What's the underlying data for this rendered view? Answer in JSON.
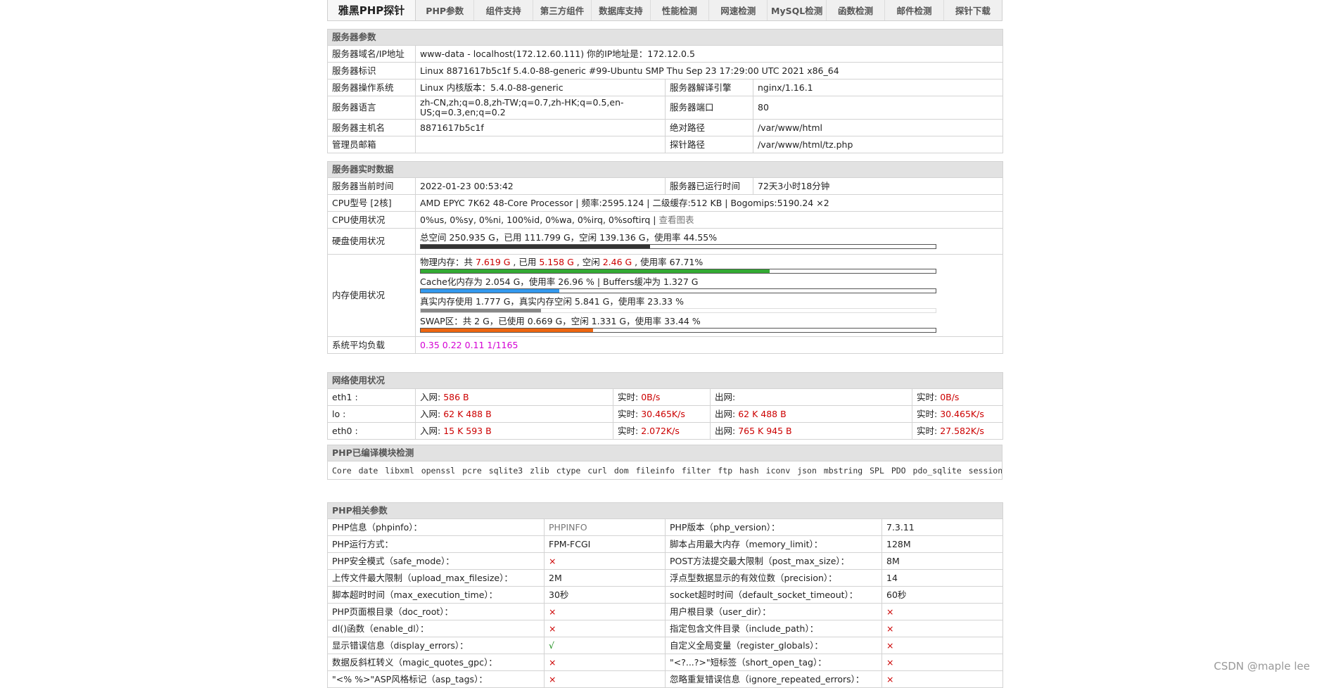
{
  "nav": {
    "brand": "雅黑PHP探针",
    "links": [
      "PHP参数",
      "组件支持",
      "第三方组件",
      "数据库支持",
      "性能检测",
      "网速检测",
      "MySQL检测",
      "函数检测",
      "邮件检测",
      "探针下载"
    ]
  },
  "server": {
    "title": "服务器参数",
    "rows": {
      "domain_label": "服务器域名/IP地址",
      "domain_value": "www-data - localhost(172.12.60.111)  你的IP地址是：172.12.0.5",
      "id_label": "服务器标识",
      "id_value": "Linux 8871617b5c1f 5.4.0-88-generic #99-Ubuntu SMP Thu Sep 23 17:29:00 UTC 2021 x86_64",
      "os_label": "服务器操作系统",
      "os_value": "Linux  内核版本：5.4.0-88-generic",
      "engine_label": "服务器解译引擎",
      "engine_value": "nginx/1.16.1",
      "lang_label": "服务器语言",
      "lang_value": "zh-CN,zh;q=0.8,zh-TW;q=0.7,zh-HK;q=0.5,en-US;q=0.3,en;q=0.2",
      "port_label": "服务器端口",
      "port_value": "80",
      "host_label": "服务器主机名",
      "host_value": "8871617b5c1f",
      "abs_label": "绝对路径",
      "abs_value": "/var/www/html",
      "admin_label": "管理员邮箱",
      "admin_value": "",
      "probe_label": "探针路径",
      "probe_value": "/var/www/html/tz.php"
    }
  },
  "realtime": {
    "title": "服务器实时数据",
    "time_label": "服务器当前时间",
    "time_value": "2022-01-23 00:53:42",
    "uptime_label": "服务器已运行时间",
    "uptime_value": "72天3小时18分钟",
    "cpu_model_label": "CPU型号 [2核]",
    "cpu_model_value": "AMD EPYC 7K62 48-Core Processor | 频率:2595.124 | 二级缓存:512 KB | Bogomips:5190.24 ×2",
    "cpu_usage_label": "CPU使用状况",
    "cpu_usage_value": "0%us, 0%sy, 0%ni, 100%id, 0%wa, 0%irq, 0%softirq |",
    "cpu_chart_link": "查看图表",
    "disk_label": "硬盘使用状况",
    "disk_value": "总空间 250.935 G，已用 111.799 G，空闲 139.136 G，使用率 44.55%",
    "disk_pct": 0.4455,
    "mem_label": "内存使用状况",
    "mem_physical": {
      "a": "物理内存：共 ",
      "total": "7.619 G",
      "b": " , 已用 ",
      "used": "5.158 G",
      "c": " , 空闲 ",
      "free": "2.46 G",
      "d": " , 使用率 67.71%"
    },
    "mem_physical_pct": 0.6771,
    "mem_cache": "Cache化内存为 2.054 G，使用率 26.96 % | Buffers缓冲为 1.327 G",
    "mem_cache_pct": 0.2696,
    "mem_real": "真实内存使用 1.777 G，真实内存空闲 5.841 G，使用率 23.33 %",
    "mem_real_pct": 0.2333,
    "mem_swap": "SWAP区：共 2 G，已使用 0.669 G，空闲 1.331 G，使用率 33.44 %",
    "mem_swap_pct": 0.3344,
    "load_label": "系统平均负载",
    "load_value": "0.35 0.22 0.11 1/1165",
    "colors": {
      "disk": "#333333",
      "physical": "#33aa33",
      "cache": "#3399ee",
      "real": "#888888",
      "swap": "#ee6611"
    }
  },
  "network": {
    "title": "网络使用状况",
    "in_label": "入网: ",
    "out_label": "出网: ",
    "rt_label": "实时: ",
    "rows": [
      {
        "name": "eth1 :",
        "in": "586 B",
        "in_rt": "0B/s",
        "out": "",
        "out_rt": "0B/s"
      },
      {
        "name": "lo :",
        "in": "62 K 488 B",
        "in_rt": "30.465K/s",
        "out": "62 K 488 B",
        "out_rt": "30.465K/s"
      },
      {
        "name": "eth0 :",
        "in": "15 K 593 B",
        "in_rt": "2.072K/s",
        "out": "765 K 945 B",
        "out_rt": "27.582K/s"
      }
    ]
  },
  "modules": {
    "title": "PHP已编译模块检测",
    "list": "Core  date  libxml  openssl  pcre  sqlite3  zlib  ctype  curl  dom  fileinfo  filter  ftp  hash  iconv  json  mbstring  SPL  PDO  pdo_sqlite  session  posix  readline  Reflection  standard  SimpleXML  Phar  tokenizer  xml  xmlreader  xmlwriter  mysqlnd  cgi-fcgi  mysqli  pdo_mysql  sodium"
  },
  "php": {
    "title": "PHP相关参数",
    "rows": [
      {
        "l1": "PHP信息（phpinfo）：",
        "v1": "PHPINFO",
        "c1": "grey",
        "l2": "PHP版本（php_version）：",
        "v2": "7.3.11",
        "c2": ""
      },
      {
        "l1": "PHP运行方式：",
        "v1": "FPM-FCGI",
        "c1": "",
        "l2": "脚本占用最大内存（memory_limit）：",
        "v2": "128M",
        "c2": ""
      },
      {
        "l1": "PHP安全模式（safe_mode）：",
        "v1": "×",
        "c1": "red",
        "l2": "POST方法提交最大限制（post_max_size）：",
        "v2": "8M",
        "c2": ""
      },
      {
        "l1": "上传文件最大限制（upload_max_filesize）：",
        "v1": "2M",
        "c1": "",
        "l2": "浮点型数据显示的有效位数（precision）：",
        "v2": "14",
        "c2": ""
      },
      {
        "l1": "脚本超时时间（max_execution_time）：",
        "v1": "30秒",
        "c1": "",
        "l2": "socket超时时间（default_socket_timeout）：",
        "v2": "60秒",
        "c2": ""
      },
      {
        "l1": "PHP页面根目录（doc_root）：",
        "v1": "×",
        "c1": "red",
        "l2": "用户根目录（user_dir）：",
        "v2": "×",
        "c2": "red"
      },
      {
        "l1": "dl()函数（enable_dl）：",
        "v1": "×",
        "c1": "red",
        "l2": "指定包含文件目录（include_path）：",
        "v2": "×",
        "c2": "red"
      },
      {
        "l1": "显示错误信息（display_errors）：",
        "v1": "√",
        "c1": "green",
        "l2": "自定义全局变量（register_globals）：",
        "v2": "×",
        "c2": "red"
      },
      {
        "l1": "数据反斜杠转义（magic_quotes_gpc）：",
        "v1": "×",
        "c1": "red",
        "l2": "\"<?...?>\"短标签（short_open_tag）：",
        "v2": "×",
        "c2": "red"
      },
      {
        "l1": "\"<% %>\"ASP风格标记（asp_tags）：",
        "v1": "×",
        "c1": "red",
        "l2": "忽略重复错误信息（ignore_repeated_errors）：",
        "v2": "×",
        "c2": "red"
      }
    ]
  },
  "watermark": "CSDN @maple lee"
}
